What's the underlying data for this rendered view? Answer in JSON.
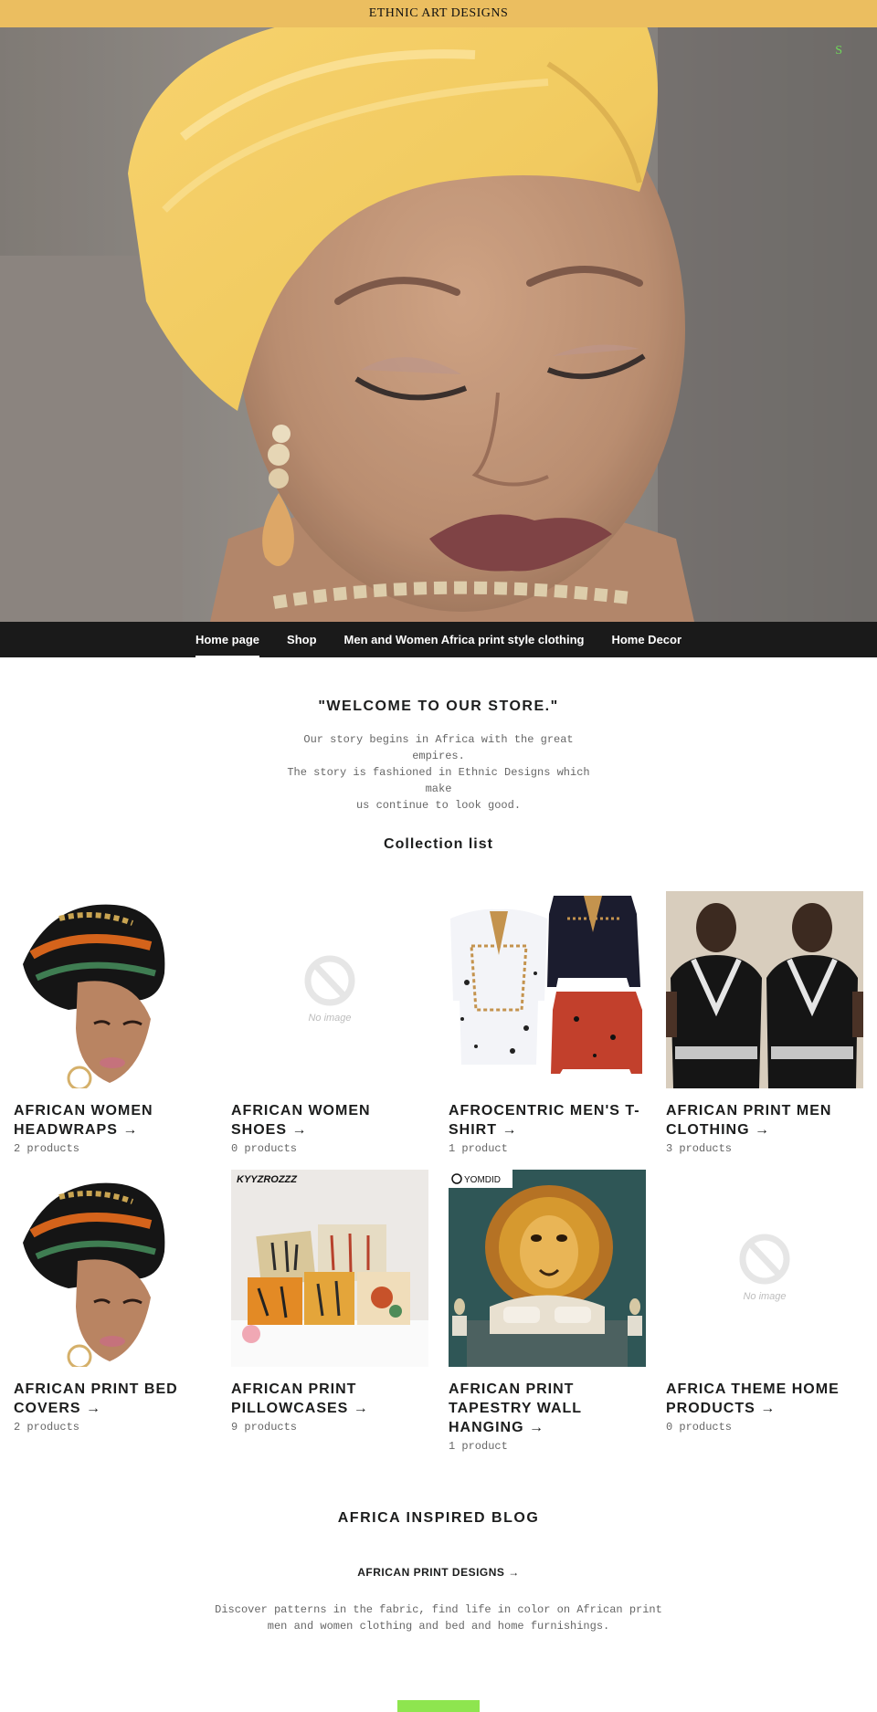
{
  "announcement": {
    "text": "ETHNIC ART DESIGNS"
  },
  "header": {
    "cart_glyph": "S"
  },
  "nav": {
    "items": [
      {
        "label": "Home page",
        "active": true
      },
      {
        "label": "Shop"
      },
      {
        "label": "Men and Women Africa print style clothing"
      },
      {
        "label": "Home Decor"
      }
    ]
  },
  "welcome": {
    "title": "\"WELCOME TO OUR STORE.\"",
    "text": "Our story begins in Africa with the great empires.\nThe story is fashioned in Ethnic Designs which make\nus continue to  look good."
  },
  "collections": {
    "title": "Collection list",
    "items": [
      {
        "title": "AFRICAN WOMEN HEADWRAPS →",
        "count": "2 products",
        "image": "headwrap"
      },
      {
        "title": "AFRICAN WOMEN SHOES →",
        "count": "0 products",
        "image": "no-image",
        "no_image_text": "No image"
      },
      {
        "title": "AFROCENTRIC MEN'S T-SHIRT →",
        "count": "1 product",
        "image": "tshirts"
      },
      {
        "title": "AFRICAN PRINT MEN CLOTHING →",
        "count": "3 products",
        "image": "men-clothing"
      },
      {
        "title": "AFRICAN PRINT BED COVERS →",
        "count": "2 products",
        "image": "headwrap"
      },
      {
        "title": "AFRICAN PRINT PILLOWCASES →",
        "count": "9 products",
        "image": "pillows",
        "image_text": "KYYZROZZZ"
      },
      {
        "title": "AFRICAN PRINT TAPESTRY WALL HANGING →",
        "count": "1 product",
        "image": "tapestry",
        "image_text": "YOMDID"
      },
      {
        "title": "AFRICA THEME HOME PRODUCTS →",
        "count": "0 products",
        "image": "no-image",
        "no_image_text": "No image"
      }
    ]
  },
  "blog": {
    "title": "AFRICA INSPIRED BLOG",
    "post_title": "AFRICAN PRINT DESIGNS →",
    "post_text": "Discover patterns in the fabric, find life in color on African print men and women clothing and bed and home furnishings."
  },
  "colors": {
    "announcement_bg": "#ebbe60",
    "nav_bg": "#1a1a1a",
    "button_green": "#8ee54f",
    "cart_green": "#6fd95a"
  }
}
